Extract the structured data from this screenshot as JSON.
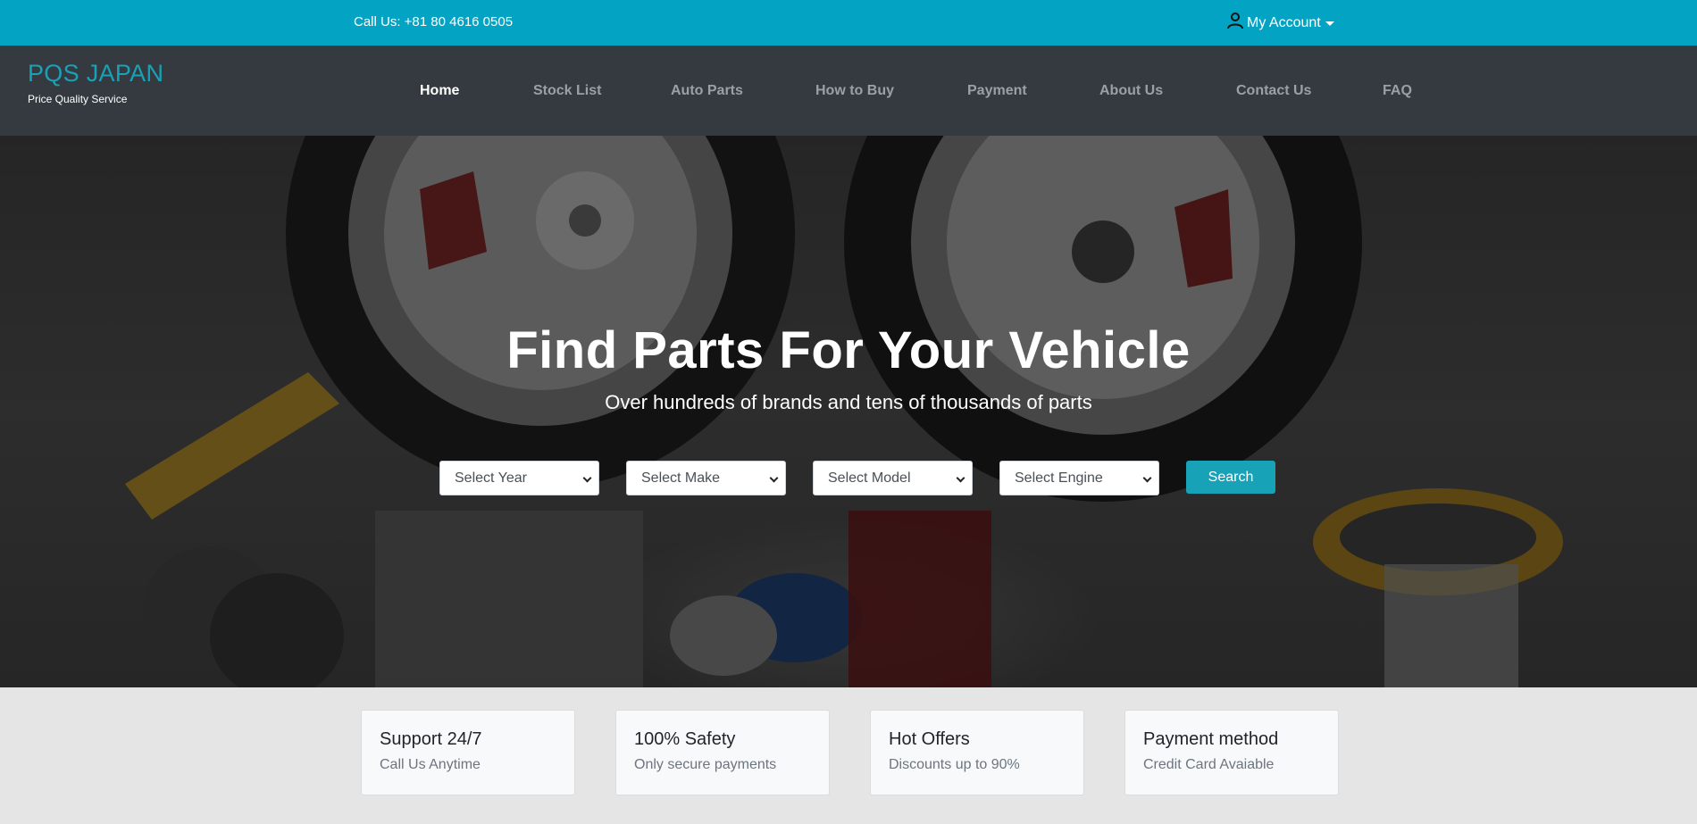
{
  "topbar": {
    "call_text": "Call Us: +81 80 4616 0505",
    "account_label": "My Account",
    "account_icon": "person-icon"
  },
  "brand": {
    "name": "PQS JAPAN",
    "tagline": "Price Quality Service"
  },
  "nav": {
    "items": [
      {
        "label": "Home",
        "active": true
      },
      {
        "label": "Stock List",
        "active": false
      },
      {
        "label": "Auto Parts",
        "active": false
      },
      {
        "label": "How to Buy",
        "active": false
      },
      {
        "label": "Payment",
        "active": false
      },
      {
        "label": "About Us",
        "active": false
      },
      {
        "label": "Contact Us",
        "active": false
      },
      {
        "label": "FAQ",
        "active": false
      }
    ]
  },
  "hero": {
    "title": "Find Parts For Your Vehicle",
    "subtitle": "Over hundreds of brands and tens of thousands of parts",
    "selects": [
      {
        "selected": "Select Year"
      },
      {
        "selected": "Select Make"
      },
      {
        "selected": "Select Model"
      },
      {
        "selected": "Select Engine"
      }
    ],
    "search_label": "Search"
  },
  "features": [
    {
      "title": "Support 24/7",
      "desc": "Call Us Anytime"
    },
    {
      "title": "100% Safety",
      "desc": "Only secure payments"
    },
    {
      "title": "Hot Offers",
      "desc": "Discounts up to 90%"
    },
    {
      "title": "Payment method",
      "desc": "Credit Card Avaiable"
    }
  ],
  "colors": {
    "accent": "#17a2b8",
    "topbar": "#02a3c3",
    "navbar": "#343a40"
  }
}
